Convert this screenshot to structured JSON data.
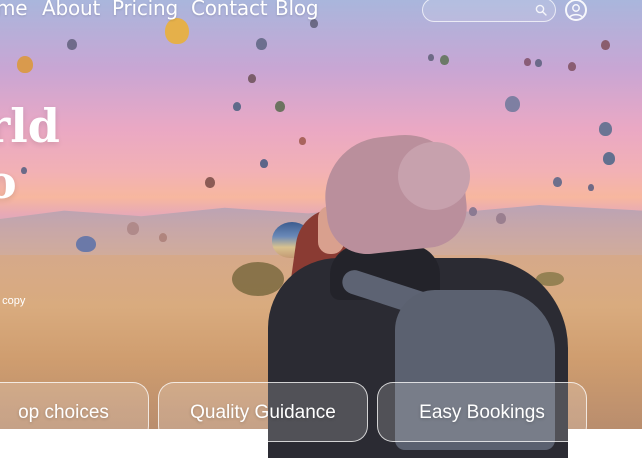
{
  "nav": {
    "links": [
      {
        "label": "me"
      },
      {
        "label": "About"
      },
      {
        "label": "Pricing"
      },
      {
        "label": "Contact"
      },
      {
        "label": "Blog"
      }
    ],
    "search": {
      "value": "",
      "placeholder": ""
    }
  },
  "hero": {
    "title_line1": "rld",
    "title_line2": "o",
    "copy": "t copy"
  },
  "features": [
    {
      "label": "op choices"
    },
    {
      "label": "Quality Guidance"
    },
    {
      "label": "Easy Bookings"
    }
  ],
  "colors": {
    "text": "#ffffff",
    "card_border": "#ffffff"
  },
  "icons": {
    "search": "search-icon",
    "user": "user-icon"
  }
}
